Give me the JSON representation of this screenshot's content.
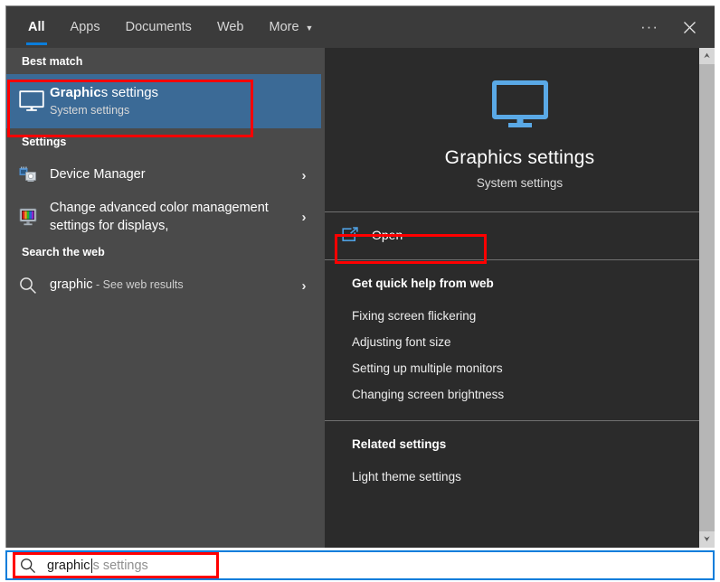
{
  "window": {
    "more_button": "···",
    "close_button": "✕"
  },
  "tabs": [
    {
      "label": "All",
      "active": true
    },
    {
      "label": "Apps",
      "active": false
    },
    {
      "label": "Documents",
      "active": false
    },
    {
      "label": "Web",
      "active": false
    },
    {
      "label": "More",
      "active": false,
      "caret": "▼"
    }
  ],
  "left_panel": {
    "best_match": {
      "header": "Best match",
      "icon": "monitor-icon",
      "title_bold": "Graphic",
      "title_rest": "s settings",
      "subtitle": "System settings",
      "highlight_color": "#3b6a96"
    },
    "settings": {
      "header": "Settings",
      "items": [
        {
          "icon": "device-manager-icon",
          "title": "Device Manager",
          "chevron": "›"
        },
        {
          "icon": "color-management-icon",
          "title": "Change advanced color management settings for displays,",
          "chevron": "›"
        }
      ]
    },
    "search_the_web": {
      "header": "Search the web",
      "items": [
        {
          "icon": "search-icon",
          "query": "graphic",
          "suffix": " - See web results",
          "chevron": "›"
        }
      ]
    }
  },
  "right_panel": {
    "hero": {
      "icon": "monitor-icon",
      "title": "Graphics settings",
      "subtitle": "System settings"
    },
    "actions": [
      {
        "icon": "open-external-icon",
        "label": "Open"
      }
    ],
    "quick_help": {
      "title": "Get quick help from web",
      "links": [
        "Fixing screen flickering",
        "Adjusting font size",
        "Setting up multiple monitors",
        "Changing screen brightness"
      ]
    },
    "related_settings": {
      "title": "Related settings",
      "links": [
        "Light theme settings"
      ]
    }
  },
  "scrollbar": {
    "up_arrow": "⮝",
    "down_arrow": "⮟"
  },
  "search_box": {
    "icon": "search-icon",
    "typed_text": "graphic",
    "suggestion_text": "s settings",
    "accent_color": "#0a7ddb"
  },
  "annotations": {
    "accent_color": "#ff0000",
    "boxes": [
      "best-match-result",
      "open-action",
      "search-input"
    ]
  }
}
